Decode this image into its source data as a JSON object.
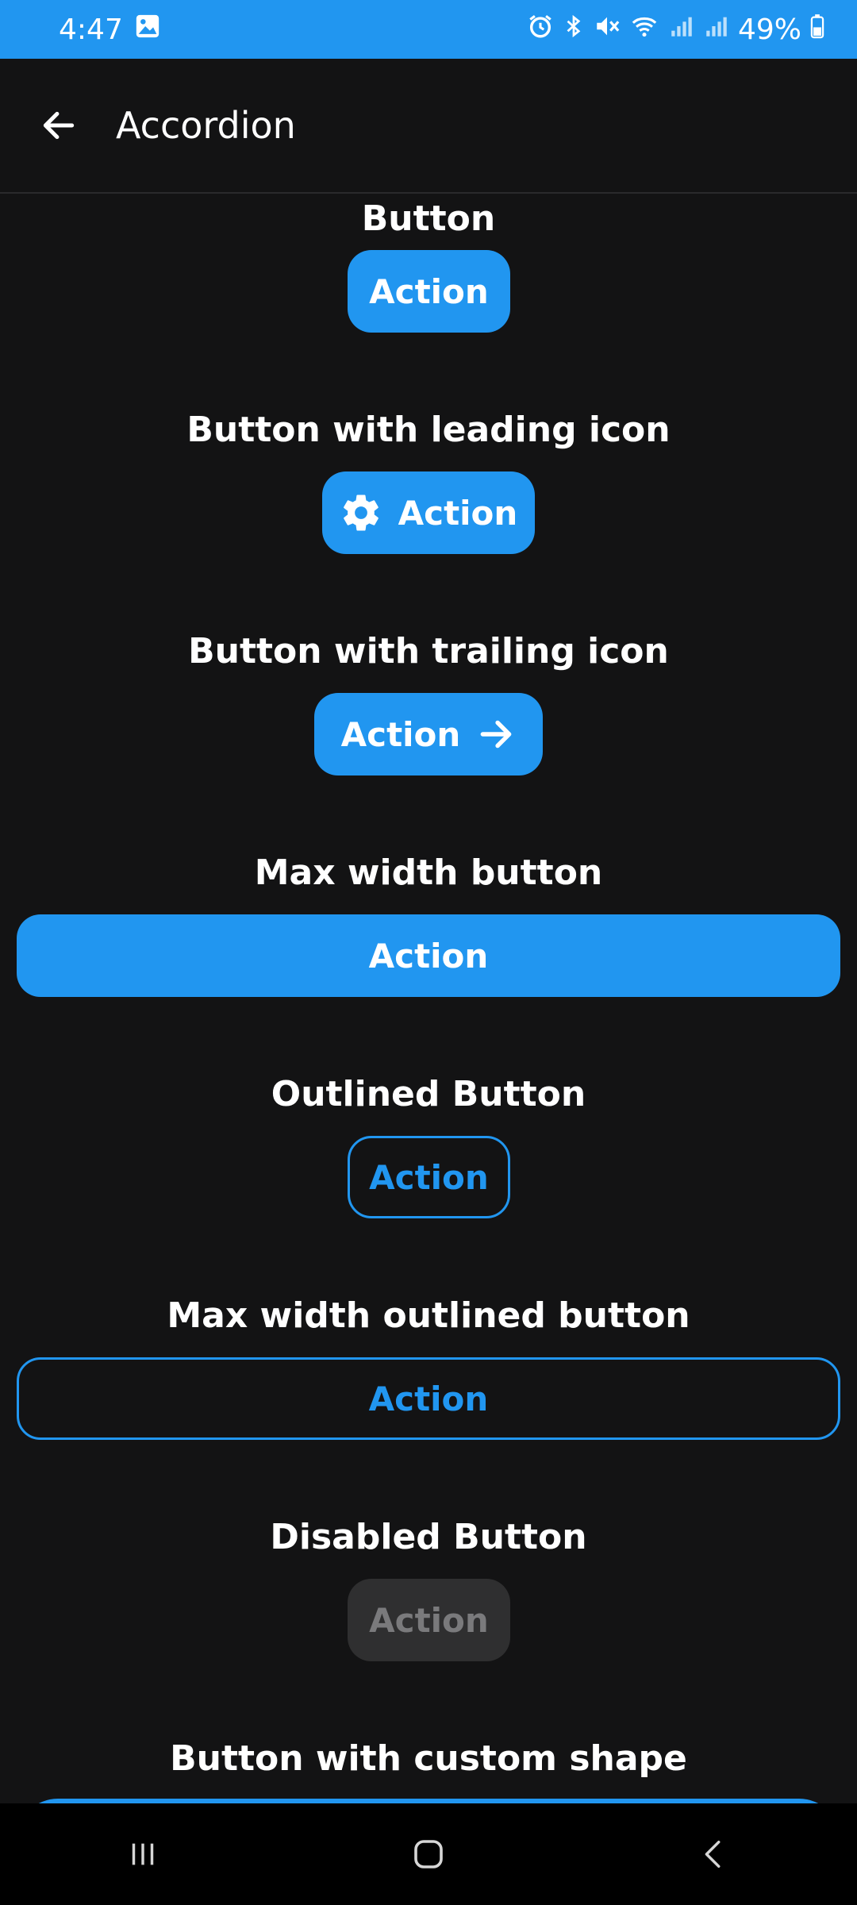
{
  "status_bar": {
    "time": "4:47",
    "battery": "49%",
    "icons": [
      "gallery-icon",
      "alarm-icon",
      "bluetooth-icon",
      "mute-icon",
      "wifi-icon",
      "signal-icon",
      "signal-icon",
      "battery-icon"
    ]
  },
  "app_bar": {
    "title": "Accordion",
    "back_icon": "arrow-left-icon"
  },
  "sections": [
    {
      "title": "Button",
      "button_label": "Action"
    },
    {
      "title": "Button with leading icon",
      "button_label": "Action",
      "icon": "gear-icon"
    },
    {
      "title": "Button with trailing icon",
      "button_label": "Action",
      "icon": "arrow-right-icon"
    },
    {
      "title": "Max width button",
      "button_label": "Action"
    },
    {
      "title": "Outlined Button",
      "button_label": "Action"
    },
    {
      "title": "Max width outlined button",
      "button_label": "Action"
    },
    {
      "title": "Disabled Button",
      "button_label": "Action"
    },
    {
      "title": "Button with custom shape",
      "button_label": ""
    }
  ],
  "colors": {
    "accent": "#2196f0",
    "background": "#131314",
    "disabled_bg": "#2f2f30",
    "disabled_text": "#7a7a7c"
  },
  "nav_bar": {
    "icons": [
      "recents-icon",
      "home-icon",
      "back-icon"
    ]
  }
}
